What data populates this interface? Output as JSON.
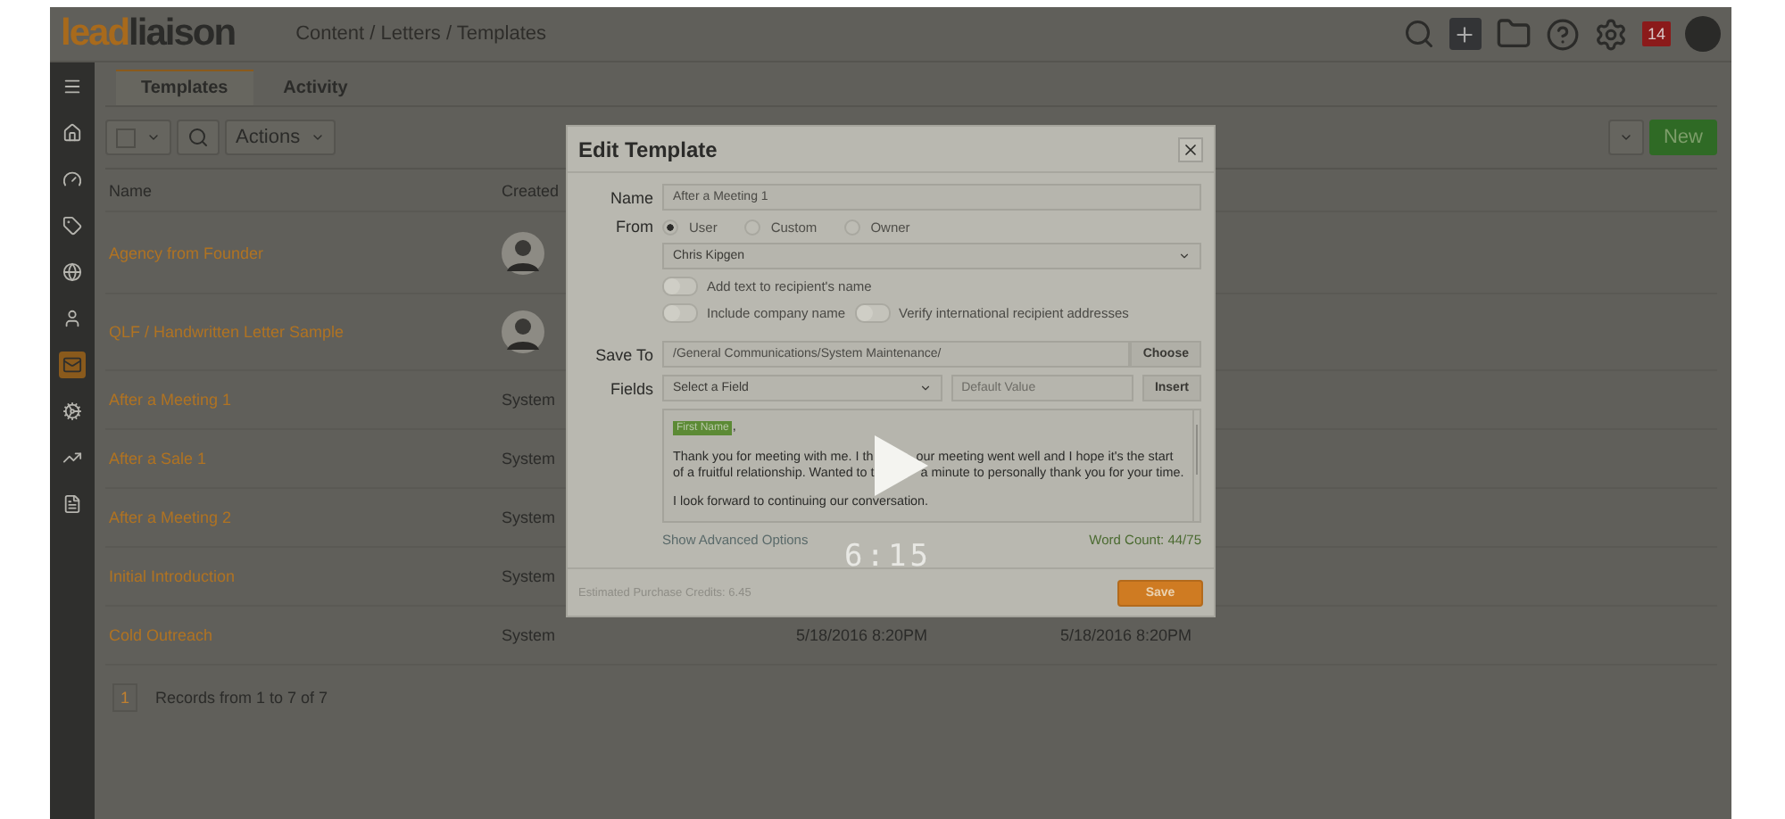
{
  "header": {
    "logo_prefix": "lead",
    "logo_suffix": "liaison",
    "breadcrumb": "Content / Letters / Templates",
    "notification_count": "14"
  },
  "sidebar": {
    "items": [
      {
        "kind": "menu",
        "selected": false
      },
      {
        "kind": "home",
        "selected": false
      },
      {
        "kind": "gauge",
        "selected": false
      },
      {
        "kind": "tag",
        "selected": false
      },
      {
        "kind": "globe",
        "selected": false
      },
      {
        "kind": "person",
        "selected": false
      },
      {
        "kind": "envelope",
        "selected": true
      },
      {
        "kind": "gears",
        "selected": false
      },
      {
        "kind": "chart",
        "selected": false
      },
      {
        "kind": "document",
        "selected": false
      }
    ]
  },
  "tabs": [
    {
      "label": "Templates",
      "selected": true
    },
    {
      "label": "Activity",
      "selected": false
    }
  ],
  "toolbar": {
    "checked": false,
    "actions": "Actions",
    "new_button": "New"
  },
  "table": {
    "columns": [
      "Name",
      "Created"
    ],
    "rows": [
      {
        "name": "Agency from Founder",
        "avatar": true
      },
      {
        "name": "QLF / Handwritten Letter Sample",
        "avatar": true
      },
      {
        "name": "After a Meeting 1",
        "created_by": "System",
        "avatar": false
      },
      {
        "name": "After a Sale 1",
        "created_by": "System",
        "avatar": false
      },
      {
        "name": "After a Meeting 2",
        "created_by": "System",
        "avatar": false
      },
      {
        "name": "Initial Introduction",
        "created_by": "System",
        "avatar": false
      },
      {
        "name": "Cold Outreach",
        "created_by": "System",
        "avatar": false,
        "column_3": "5/18/2016 8:20PM",
        "column_4": "5/18/2016 8:20PM"
      }
    ]
  },
  "pagination": {
    "page": "1",
    "summary": "Records from 1 to 7 of 7"
  },
  "dialog": {
    "title": "Edit Template",
    "name_label": "Name",
    "name_value": "After a Meeting 1",
    "from_label": "From",
    "from_options": [
      {
        "label": "User",
        "selected": true
      },
      {
        "label": "Custom",
        "selected": false
      },
      {
        "label": "Owner",
        "selected": false
      }
    ],
    "from_select": "Chris Kipgen",
    "toggles": [
      {
        "label": "Add text to recipient's name",
        "on": false
      },
      {
        "label": "Include company name",
        "on": false
      },
      {
        "label": "Verify international recipient addresses",
        "on": false
      }
    ],
    "save_to_label": "Save To",
    "save_to_value": "/General Communications/System Maintenance/",
    "choose_button": "Choose",
    "fields_label": "Fields",
    "field_select": "Select a Field",
    "default_placeholder": "Default Value",
    "insert_button": "Insert",
    "editor": {
      "token": "First Name",
      "token_suffix": ",",
      "lines": [
        [
          "Thank you for meeting with me. I th",
          "our meeting went well and I hope it's the start"
        ],
        [
          "of a fruitful relationship. Wanted to t",
          "a minute to personally thank you for your time."
        ]
      ],
      "paragraph": "I look forward to continuing our conversation."
    },
    "advanced_link": "Show Advanced Options",
    "word_count": "Word Count: 44/75",
    "credits": "Estimated Purchase Credits: 6.45",
    "save_button": "Save"
  },
  "video": {
    "time": "6:15"
  }
}
